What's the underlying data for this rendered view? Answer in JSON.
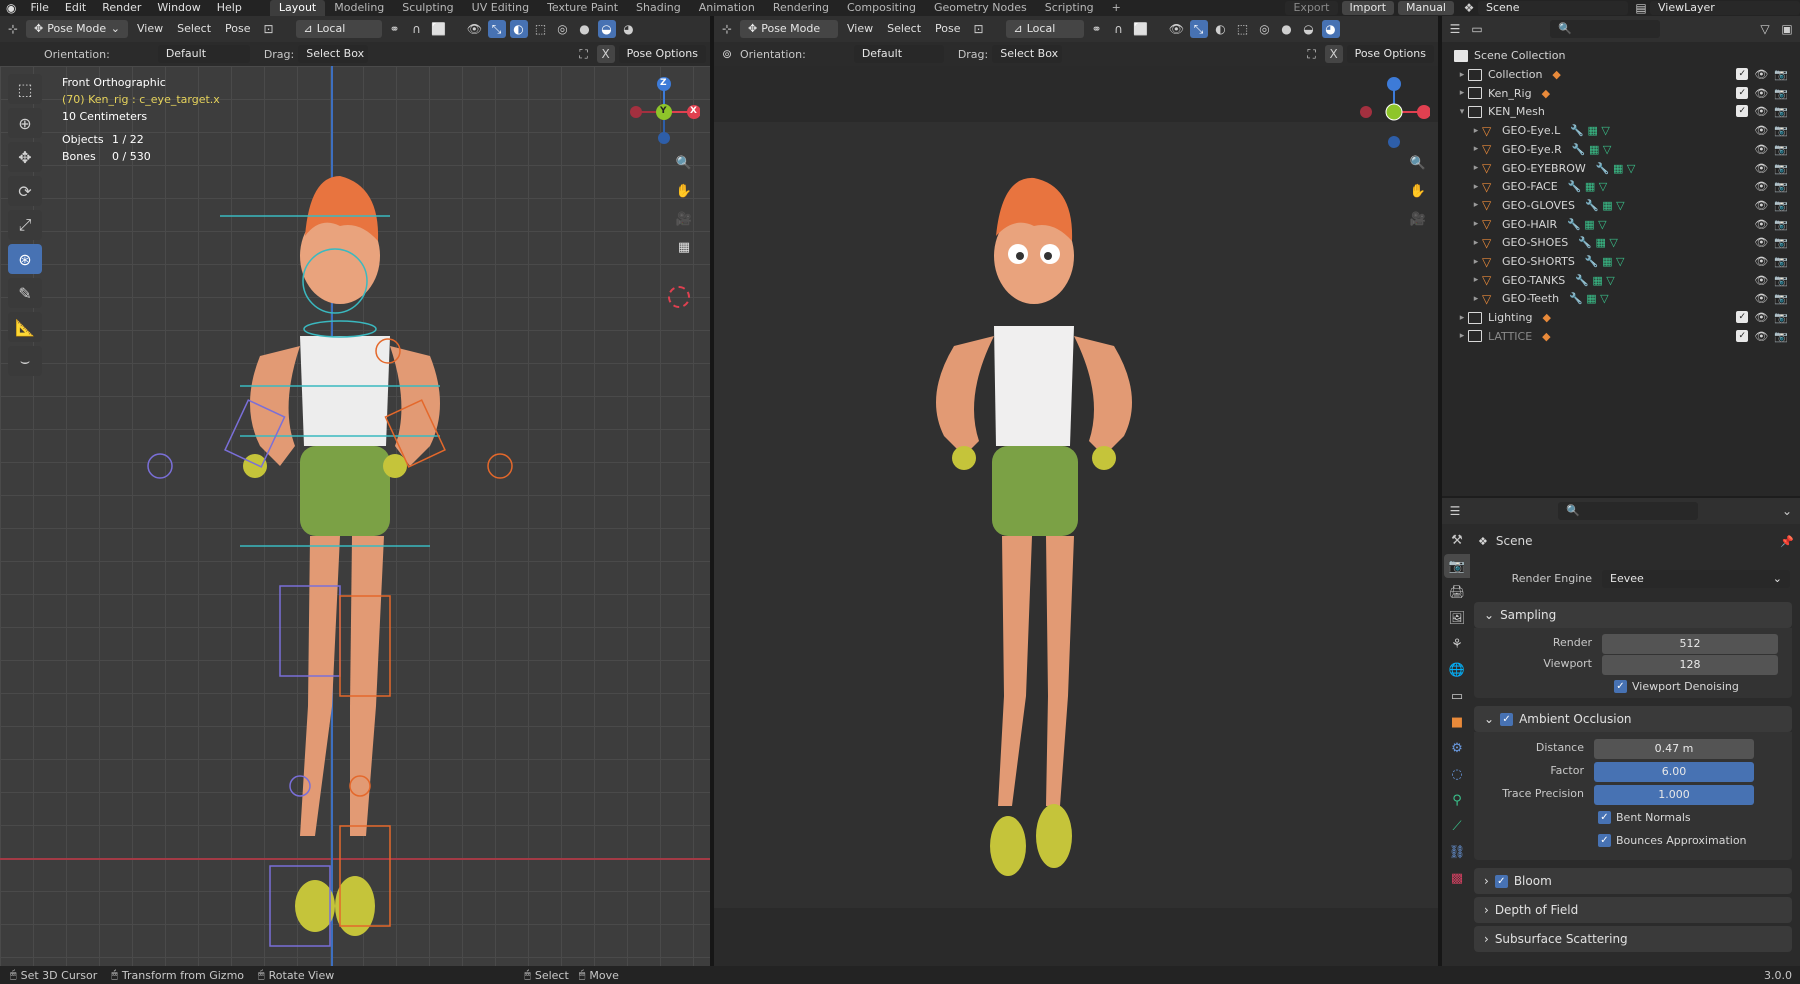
{
  "top_menu": {
    "logo_icon": "blender-logo-icon",
    "items": [
      "File",
      "Edit",
      "Render",
      "Window",
      "Help"
    ],
    "workspaces": [
      "Layout",
      "Modeling",
      "Sculpting",
      "UV Editing",
      "Texture Paint",
      "Shading",
      "Animation",
      "Rendering",
      "Compositing",
      "Geometry Nodes",
      "Scripting"
    ],
    "active_workspace": "Layout",
    "add_tab": "+",
    "export_label": "Export",
    "import_label": "Import",
    "manual_label": "Manual",
    "scene_name": "Scene",
    "view_layer": "ViewLayer"
  },
  "left_viewport": {
    "mode": "Pose Mode",
    "menus": [
      "View",
      "Select",
      "Pose"
    ],
    "transform_orientation": "Local",
    "orientation_label": "Orientation:",
    "orientation_value": "Default",
    "drag_label": "Drag:",
    "drag_value": "Select Box",
    "pose_options": "Pose Options",
    "overlay_title": "Front Orthographic",
    "active_bone": "(70) Ken_rig : c_eye_target.x",
    "scale_text": "10 Centimeters",
    "objects_label": "Objects",
    "objects_value": "1 / 22",
    "bones_label": "Bones",
    "bones_value": "0 / 530",
    "axis_x": "X",
    "axis_y": "Y",
    "axis_z": "Z"
  },
  "right_viewport": {
    "mode": "Pose Mode",
    "menus": [
      "View",
      "Select",
      "Pose"
    ],
    "transform_orientation": "Local",
    "orientation_label": "Orientation:",
    "orientation_value": "Default",
    "drag_label": "Drag:",
    "drag_value": "Select Box",
    "pose_options": "Pose Options"
  },
  "outliner": {
    "root": "Scene Collection",
    "rows": [
      {
        "name": "Collection",
        "depth": 1,
        "type": "collection",
        "muted": false,
        "extras": "3"
      },
      {
        "name": "Ken_Rig",
        "depth": 1,
        "type": "collection",
        "muted": false,
        "extras": "15"
      },
      {
        "name": "KEN_Mesh",
        "depth": 1,
        "type": "collection",
        "muted": false,
        "expanded": true
      },
      {
        "name": "GEO-Eye.L",
        "depth": 2,
        "type": "mesh",
        "muted": false
      },
      {
        "name": "GEO-Eye.R",
        "depth": 2,
        "type": "mesh",
        "muted": false
      },
      {
        "name": "GEO-EYEBROW",
        "depth": 2,
        "type": "mesh",
        "muted": false
      },
      {
        "name": "GEO-FACE",
        "depth": 2,
        "type": "mesh",
        "muted": false
      },
      {
        "name": "GEO-GLOVES",
        "depth": 2,
        "type": "mesh",
        "muted": false
      },
      {
        "name": "GEO-HAIR",
        "depth": 2,
        "type": "mesh",
        "muted": false
      },
      {
        "name": "GEO-SHOES",
        "depth": 2,
        "type": "mesh",
        "muted": false
      },
      {
        "name": "GEO-SHORTS",
        "depth": 2,
        "type": "mesh",
        "muted": false
      },
      {
        "name": "GEO-TANKS",
        "depth": 2,
        "type": "mesh",
        "muted": false
      },
      {
        "name": "GEO-Teeth",
        "depth": 2,
        "type": "mesh",
        "muted": false
      },
      {
        "name": "Lighting",
        "depth": 1,
        "type": "collection",
        "muted": false,
        "extras": "9"
      },
      {
        "name": "LATTICE",
        "depth": 1,
        "type": "collection",
        "muted": true,
        "extras": "2"
      }
    ]
  },
  "properties": {
    "context": "Scene",
    "render_engine_label": "Render Engine",
    "render_engine": "Eevee",
    "sampling": {
      "title": "Sampling",
      "render_label": "Render",
      "render": "512",
      "viewport_label": "Viewport",
      "viewport": "128",
      "denoise_label": "Viewport Denoising",
      "denoise": true
    },
    "ao": {
      "title": "Ambient Occlusion",
      "enabled": true,
      "distance_label": "Distance",
      "distance": "0.47 m",
      "factor_label": "Factor",
      "factor": "6.00",
      "trace_label": "Trace Precision",
      "trace": "1.000",
      "bent_label": "Bent Normals",
      "bent": true,
      "bounces_label": "Bounces Approximation",
      "bounces": true
    },
    "bloom": {
      "title": "Bloom",
      "enabled": true
    },
    "dof": {
      "title": "Depth of Field"
    },
    "sss": {
      "title": "Subsurface Scattering"
    }
  },
  "status_bar": {
    "items": [
      "Set 3D Cursor",
      "Transform from Gizmo",
      "Rotate View",
      "Select",
      "Move"
    ],
    "version": "3.0.0"
  },
  "colors": {
    "accent": "#4772b3",
    "axis_x": "#e04050",
    "axis_y": "#8ec52a",
    "axis_z": "#3d7bd8",
    "mesh_icon": "#e98a3a",
    "mesh_data_icon": "#3ac08a",
    "active_text": "#e6d35c"
  }
}
